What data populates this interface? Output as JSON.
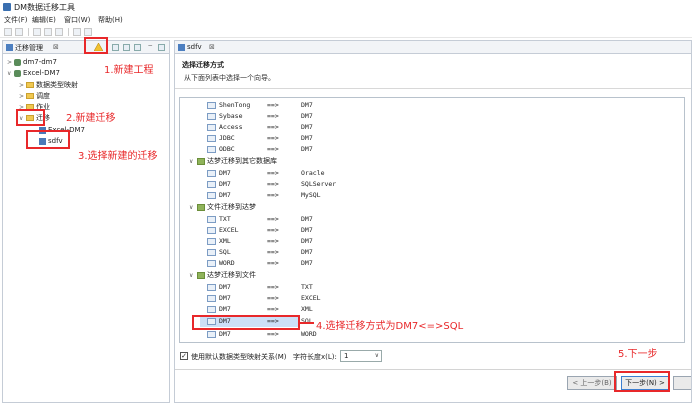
{
  "window": {
    "title": "DM数据迁移工具"
  },
  "menu": [
    {
      "label": "文件(F)"
    },
    {
      "label": "编辑(E)"
    },
    {
      "label": "窗口(W)"
    },
    {
      "label": "帮助(H)"
    }
  ],
  "left_panel": {
    "tab_label": "迁移管理",
    "tab_close": "⊠",
    "tree": [
      {
        "label": "dm7-dm7",
        "twist": ">"
      },
      {
        "label": "Excel-DM7",
        "twist": "∨"
      },
      {
        "label": "数据类型映射",
        "twist": ">"
      },
      {
        "label": "调度",
        "twist": ">"
      },
      {
        "label": "作业",
        "twist": ">"
      },
      {
        "label": "迁移",
        "twist": "∨"
      },
      {
        "label": "Excel-DM7",
        "twist": ""
      },
      {
        "label": "sdfv",
        "twist": ""
      }
    ]
  },
  "right_panel": {
    "tab_label": "sdfv",
    "tab_close": "⊠",
    "wizard_title": "选择迁移方式",
    "wizard_subtitle": "从下面列表中选择一个向导。",
    "arrow": "==>",
    "rows_top": [
      {
        "src": "ShenTong",
        "dst": "DM7"
      },
      {
        "src": "Sybase",
        "dst": "DM7"
      },
      {
        "src": "Access",
        "dst": "DM7"
      },
      {
        "src": "JDBC",
        "dst": "DM7"
      },
      {
        "src": "ODBC",
        "dst": "DM7"
      }
    ],
    "groups": [
      {
        "label": "达梦迁移到其它数据库",
        "twist": "∨",
        "rows": [
          {
            "src": "DM7",
            "dst": "Oracle"
          },
          {
            "src": "DM7",
            "dst": "SQLServer"
          },
          {
            "src": "DM7",
            "dst": "MySQL"
          }
        ]
      },
      {
        "label": "文件迁移到达梦",
        "twist": "∨",
        "rows": [
          {
            "src": "TXT",
            "dst": "DM7"
          },
          {
            "src": "EXCEL",
            "dst": "DM7"
          },
          {
            "src": "XML",
            "dst": "DM7"
          },
          {
            "src": "SQL",
            "dst": "DM7"
          },
          {
            "src": "WORD",
            "dst": "DM7"
          }
        ]
      },
      {
        "label": "达梦迁移到文件",
        "twist": "∨",
        "rows": [
          {
            "src": "DM7",
            "dst": "TXT"
          },
          {
            "src": "DM7",
            "dst": "EXCEL"
          },
          {
            "src": "DM7",
            "dst": "XML"
          },
          {
            "src": "DM7",
            "dst": "SQL"
          },
          {
            "src": "DM7",
            "dst": "WORD"
          }
        ]
      }
    ],
    "selected_row": "DM7 ==> SQL",
    "option_label": "使用默认数据类型映射关系(M)",
    "option_checked": "✓",
    "length_label": "字符长度x(L):",
    "length_value": "1",
    "length_caret": "∨",
    "prev_button": "< 上一步(B)",
    "next_button": "下一步(N) >"
  },
  "annotations": {
    "step1": "1.新建工程",
    "step2": "2.新建迁移",
    "step3": "3.选择新建的迁移",
    "step4": "4.选择迁移方式为DM7<=>SQL",
    "step5": "5.下一步"
  },
  "colors": {
    "annotation": "#e8282a",
    "selection": "#cde0f7",
    "accent": "#3c7fd0"
  }
}
